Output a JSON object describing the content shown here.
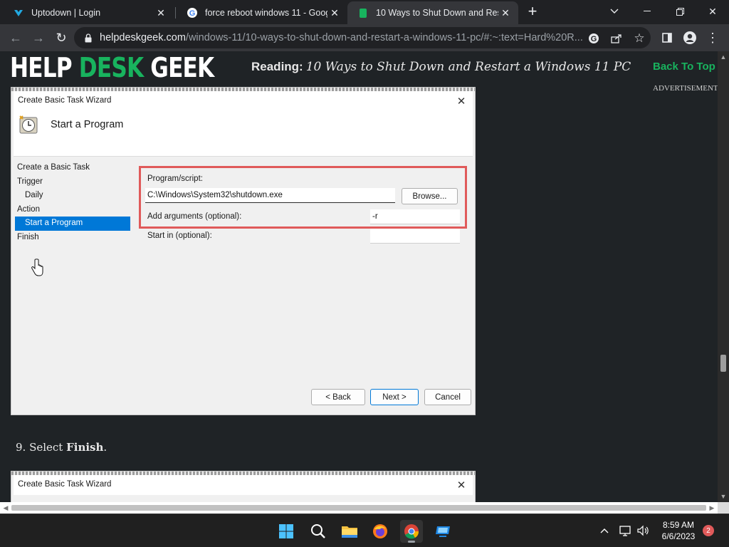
{
  "browser": {
    "tabs": [
      {
        "title": "Uptodown | Login",
        "icon": "uptodown-favicon",
        "active": false
      },
      {
        "title": "force reboot windows 11 - Goog",
        "icon": "google-favicon",
        "active": false
      },
      {
        "title": "10 Ways to Shut Down and Resta",
        "icon": "helpdeskgeek-favicon",
        "active": true
      }
    ],
    "new_tab_label": "+",
    "url_host": "helpdeskgeek.com",
    "url_path": "/windows-11/10-ways-to-shut-down-and-restart-a-windows-11-pc/#:~:text=Hard%20R..."
  },
  "site": {
    "logo_help": "HELP ",
    "logo_desk": "DESK",
    "logo_geek": " GEEK",
    "reading_label": "Reading:",
    "reading_title": "10 Ways to Shut Down and Restart a Windows 11 PC",
    "back_to_top": "Back To Top",
    "advertisement": "ADVERTISEMENT"
  },
  "wizard": {
    "title": "Create Basic Task Wizard",
    "header": "Start a Program",
    "steps": [
      {
        "label": "Create a Basic Task",
        "sub": false,
        "selected": false
      },
      {
        "label": "Trigger",
        "sub": false,
        "selected": false
      },
      {
        "label": "Daily",
        "sub": true,
        "selected": false
      },
      {
        "label": "Action",
        "sub": false,
        "selected": false
      },
      {
        "label": "Start a Program",
        "sub": true,
        "selected": true
      },
      {
        "label": "Finish",
        "sub": false,
        "selected": false
      }
    ],
    "program_label": "Program/script:",
    "program_value": "C:\\Windows\\System32\\shutdown.exe",
    "browse": "Browse...",
    "args_label": "Add arguments (optional):",
    "args_value": "-r",
    "startin_label": "Start in (optional):",
    "startin_value": "",
    "back": "< Back",
    "next": "Next >",
    "cancel": "Cancel"
  },
  "article": {
    "step_text": "9. Select ",
    "step_bold": "Finish",
    "step_end": "."
  },
  "wizard2": {
    "title": "Create Basic Task Wizard"
  },
  "taskbar": {
    "time": "8:59 AM",
    "date": "6/6/2023",
    "notifications": "2"
  },
  "colors": {
    "brand_green": "#18b35e",
    "highlight_red": "#e05a5a",
    "selection_blue": "#0078d7"
  }
}
